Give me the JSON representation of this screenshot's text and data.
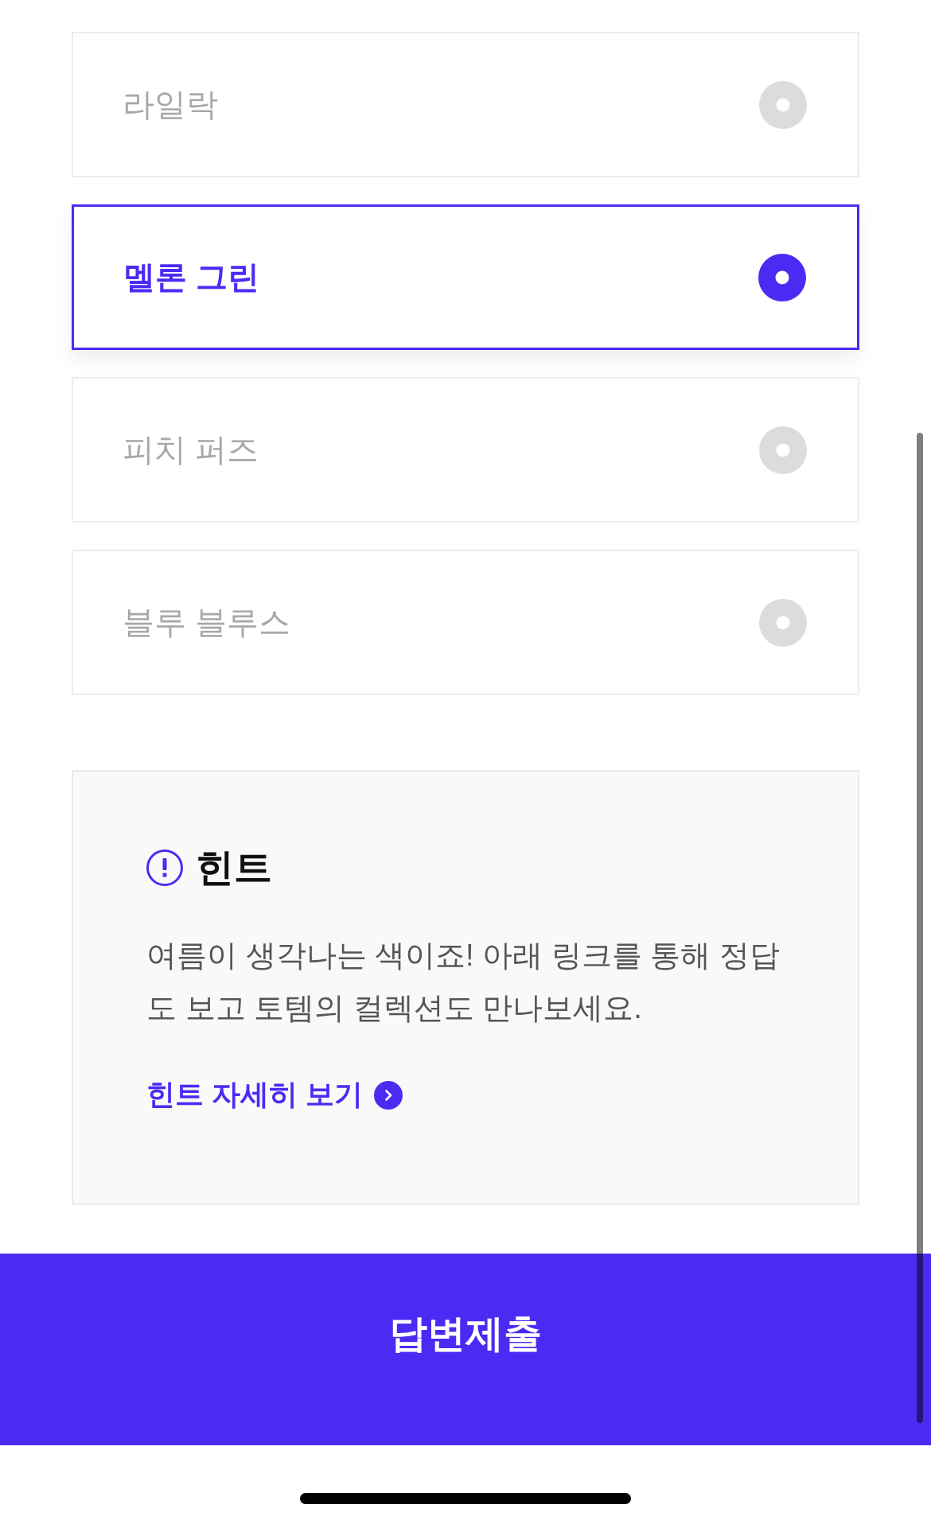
{
  "options": [
    {
      "label": "라일락",
      "selected": false
    },
    {
      "label": "멜론 그린",
      "selected": true
    },
    {
      "label": "피치 퍼즈",
      "selected": false
    },
    {
      "label": "블루 블루스",
      "selected": false
    }
  ],
  "hint": {
    "title": "힌트",
    "body": "여름이 생각나는 색이죠! 아래 링크를 통해 정답도 보고 토템의 컬렉션도 만나보세요.",
    "link": "힌트 자세히 보기"
  },
  "submit_button": {
    "label": "답변제출"
  }
}
